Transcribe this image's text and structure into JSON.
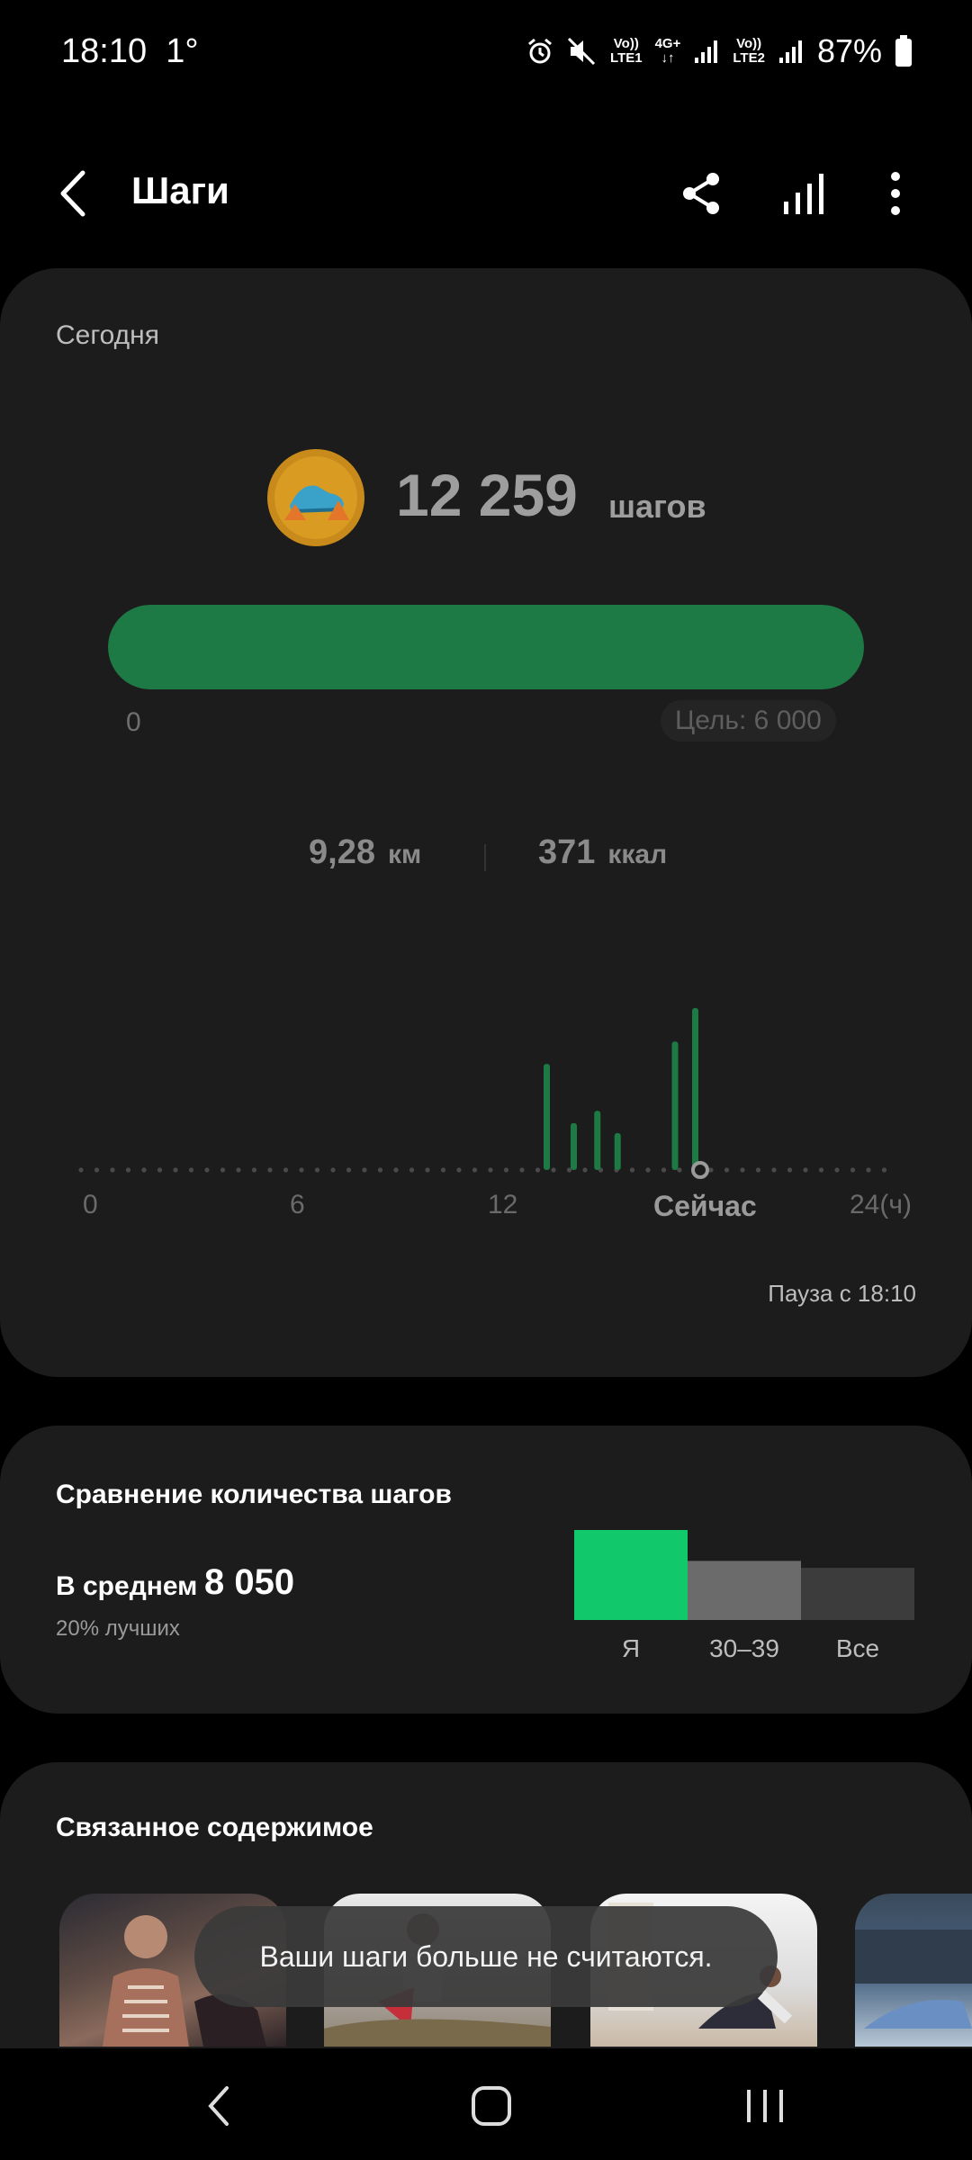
{
  "status_bar": {
    "time": "18:10",
    "temp": "1°",
    "sim1": {
      "top": "Vo))",
      "bottom": "LTE1"
    },
    "net": "4G+",
    "sim2": {
      "top": "Vo))",
      "bottom": "LTE2"
    },
    "battery": "87%"
  },
  "header": {
    "title": "Шаги",
    "icons": [
      "back-icon",
      "share-icon",
      "bar-chart-icon",
      "more-vertical-icon"
    ]
  },
  "today": {
    "label": "Сегодня",
    "steps": "12 259",
    "steps_unit": "шагов",
    "progress_fraction": 1.0,
    "progress_min": "0",
    "goal": "Цель: 6 000",
    "distance": "9,28",
    "distance_unit": "км",
    "calories": "371",
    "calories_unit": "ккал",
    "chart_ticks": [
      "0",
      "6",
      "12",
      "24(ч)"
    ],
    "now_label": "Сейчас",
    "pause_text": "Пауза с 18:10",
    "accent": "#1d7a45"
  },
  "comparison": {
    "title": "Сравнение количества шагов",
    "avg_label": "В среднем",
    "avg_value": "8 050",
    "better_text": "20% лучших",
    "bars": [
      {
        "label": "Я",
        "value": 12259,
        "color": "#11c86b"
      },
      {
        "label": "30–39",
        "value": 8050,
        "color": "#6b6b6b"
      },
      {
        "label": "Все",
        "value": 7100,
        "color": "#3c3c3c"
      }
    ]
  },
  "related": {
    "title": "Связанное содержимое"
  },
  "toast": "Ваши шаги больше не считаются.",
  "chart_data": {
    "type": "bar",
    "x": [
      13.8,
      14.6,
      15.3,
      15.9,
      17.6,
      18.2
    ],
    "values": [
      950,
      420,
      530,
      330,
      1150,
      1450
    ],
    "xlim": [
      0,
      24
    ],
    "ticks": [
      "0",
      "6",
      "12",
      "24(ч)"
    ]
  }
}
